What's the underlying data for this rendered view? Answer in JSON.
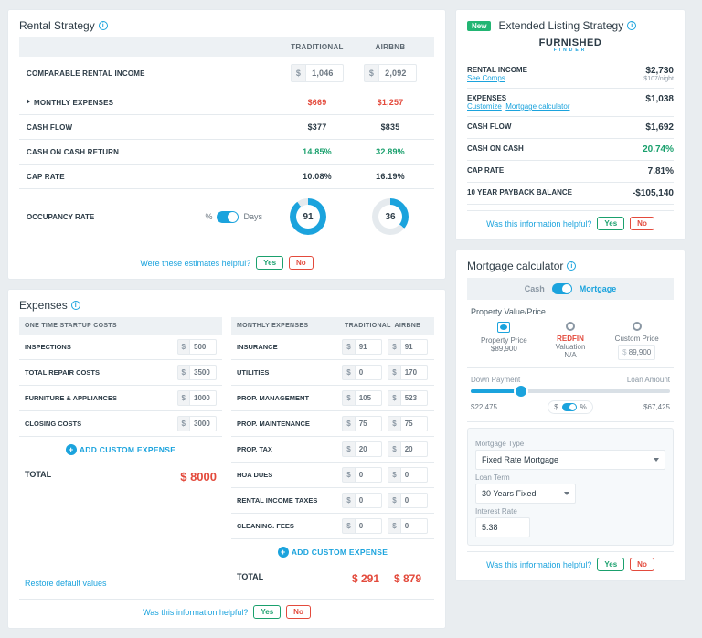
{
  "rental_strategy": {
    "title": "Rental Strategy",
    "cols": {
      "trad": "TRADITIONAL",
      "air": "AIRBNB"
    },
    "rows": {
      "income": {
        "label": "COMPARABLE RENTAL INCOME",
        "trad": "1,046",
        "air": "2,092"
      },
      "expenses": {
        "label": "MONTHLY EXPENSES",
        "trad": "$669",
        "air": "$1,257"
      },
      "cashflow": {
        "label": "CASH FLOW",
        "trad": "$377",
        "air": "$835"
      },
      "coc": {
        "label": "CASH ON CASH RETURN",
        "trad": "14.85%",
        "air": "32.89%"
      },
      "cap": {
        "label": "CAP RATE",
        "trad": "10.08%",
        "air": "16.19%"
      }
    },
    "occupancy": {
      "label": "OCCUPANCY RATE",
      "pct": "%",
      "days": "Days",
      "trad": "91",
      "air": "36"
    },
    "helpful": {
      "q": "Were these estimates helpful?",
      "yes": "Yes",
      "no": "No"
    }
  },
  "extended": {
    "badge": "New",
    "title": "Extended Listing Strategy",
    "logo": {
      "main": "FURNISHED",
      "sub": "FINDER"
    },
    "rows": {
      "income": {
        "label": "RENTAL INCOME",
        "value": "$2,730",
        "sublink": "See Comps",
        "sub": "$107/night"
      },
      "expenses": {
        "label": "EXPENSES",
        "value": "$1,038",
        "link1": "Customize",
        "link2": "Mortgage calculator"
      },
      "cashflow": {
        "label": "CASH FLOW",
        "value": "$1,692"
      },
      "coc": {
        "label": "CASH ON CASH",
        "value": "20.74%"
      },
      "cap": {
        "label": "CAP RATE",
        "value": "7.81%"
      },
      "payback": {
        "label": "10 YEAR PAYBACK BALANCE",
        "value": "-$105,140"
      }
    },
    "helpful": {
      "q": "Was this information helpful?",
      "yes": "Yes",
      "no": "No"
    }
  },
  "expenses": {
    "title": "Expenses",
    "one_time": {
      "header": "ONE TIME STARTUP COSTS",
      "items": [
        {
          "label": "INSPECTIONS",
          "v": "500"
        },
        {
          "label": "TOTAL REPAIR COSTS",
          "v": "3500"
        },
        {
          "label": "FURNITURE & APPLIANCES",
          "v": "1000"
        },
        {
          "label": "CLOSING COSTS",
          "v": "3000"
        }
      ],
      "add": "ADD CUSTOM EXPENSE",
      "total_label": "TOTAL",
      "total": "$ 8000"
    },
    "monthly": {
      "h1": "MONTHLY EXPENSES",
      "h2": "TRADITIONAL",
      "h3": "AIRBNB",
      "items": [
        {
          "label": "INSURANCE",
          "t": "91",
          "a": "91"
        },
        {
          "label": "UTILITIES",
          "t": "0",
          "a": "170"
        },
        {
          "label": "PROP. MANAGEMENT",
          "t": "105",
          "a": "523"
        },
        {
          "label": "PROP. MAINTENANCE",
          "t": "75",
          "a": "75"
        },
        {
          "label": "PROP. TAX",
          "t": "20",
          "a": "20"
        },
        {
          "label": "HOA DUES",
          "t": "0",
          "a": "0"
        },
        {
          "label": "RENTAL INCOME TAXES",
          "t": "0",
          "a": "0"
        },
        {
          "label": "CLEANING. FEES",
          "t": "0",
          "a": "0"
        }
      ],
      "add": "ADD CUSTOM EXPENSE",
      "total_label": "TOTAL",
      "total_t": "$ 291",
      "total_a": "$ 879"
    },
    "restore": "Restore default values",
    "helpful": {
      "q": "Was this information helpful?",
      "yes": "Yes",
      "no": "No"
    }
  },
  "mortgage": {
    "title": "Mortgage calculator",
    "tabs": {
      "cash": "Cash",
      "mortgage": "Mortgage"
    },
    "pvp": {
      "label": "Property Value/Price",
      "opts": [
        {
          "title": "Property Price",
          "sub": "$89,900",
          "sel": true
        },
        {
          "title": "REDFIN",
          "sub2": "Valuation",
          "sub": "N/A",
          "redfin": true
        },
        {
          "title": "Custom Price",
          "sub": "89,900",
          "input": true
        }
      ]
    },
    "down": {
      "label": "Down Payment",
      "label2": "Loan Amount",
      "v1": "$22,475",
      "pill_s": "$",
      "pill_p": "%",
      "v2": "$67,425"
    },
    "box": {
      "mt_label": "Mortgage Type",
      "mt": "Fixed Rate Mortgage",
      "lt_label": "Loan Term",
      "lt": "30 Years Fixed",
      "ir_label": "Interest Rate",
      "ir": "5.38"
    },
    "helpful": {
      "q": "Was this information helpful?",
      "yes": "Yes",
      "no": "No"
    }
  },
  "currency": "$"
}
